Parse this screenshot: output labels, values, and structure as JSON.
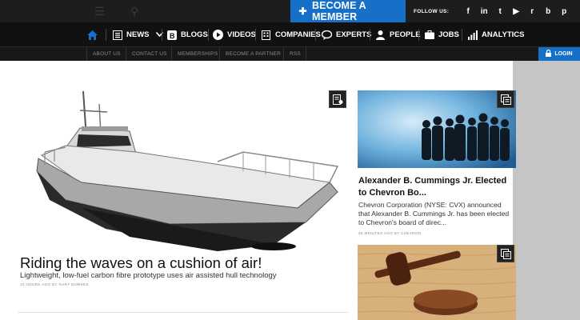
{
  "topbar": {
    "cta_label": "BECOME A MEMBER",
    "follow_label": "FOLLOW US:",
    "social": [
      {
        "name": "facebook-icon",
        "glyph": "f"
      },
      {
        "name": "linkedin-icon",
        "glyph": "in"
      },
      {
        "name": "twitter-icon",
        "glyph": "t"
      },
      {
        "name": "youtube-icon",
        "glyph": "▶"
      },
      {
        "name": "reddit-icon",
        "glyph": "r"
      },
      {
        "name": "blog-icon",
        "glyph": "b"
      },
      {
        "name": "pinterest-icon",
        "glyph": "p"
      }
    ]
  },
  "nav": {
    "items": [
      "NEWS",
      "BLOGS",
      "VIDEOS",
      "COMPANIES",
      "EXPERTS",
      "PEOPLE",
      "JOBS",
      "ANALYTICS"
    ],
    "home_icon": "home-icon"
  },
  "subnav": {
    "items": [
      "ABOUT US",
      "CONTACT US",
      "MEMBERSHIPS",
      "BECOME A PARTNER",
      "RSS"
    ],
    "login_label": "LOGIN"
  },
  "feature": {
    "title": "Riding the waves on a cushion of air!",
    "subtitle": "Lightweight, low-fuel carbon fibre prototype uses air assisted hull technology",
    "meta": "10 HOURS AGO BY GARY DAWKES"
  },
  "cards": [
    {
      "title": "Alexander B. Cummings Jr. Elected to Chevron Bo...",
      "text": "Chevron Corporation (NYSE: CVX) announced that Alexander B. Cummings Jr. has been elected to Chevron's board of direc...",
      "meta": "26 MINUTES AGO BY CHEVRON"
    }
  ],
  "colors": {
    "accent": "#1670c8",
    "topbar": "#1d1d1d",
    "nav": "#111111"
  }
}
